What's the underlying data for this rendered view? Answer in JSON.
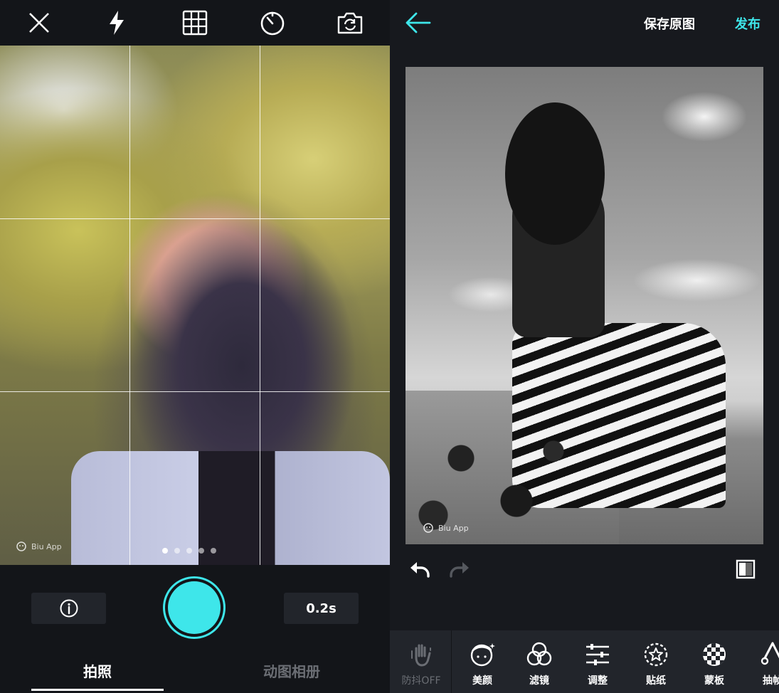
{
  "camera": {
    "top_icons": [
      "close-icon",
      "flash-icon",
      "grid-icon",
      "timer-icon",
      "switch-camera-icon"
    ],
    "watermark": "Biu App",
    "page_dots": 5,
    "active_dot": 0,
    "info_icon": "info-icon",
    "duration": "0.2s",
    "tabs": [
      {
        "label": "拍照",
        "active": true
      },
      {
        "label": "动图相册",
        "active": false
      }
    ],
    "accent": "#3ee6ea"
  },
  "editor": {
    "save_original": "保存原图",
    "publish": "发布",
    "watermark": "Biu App",
    "tools": [
      {
        "label": "防抖OFF",
        "icon": "hand-icon",
        "enabled": false
      },
      {
        "label": "美颜",
        "icon": "face-icon",
        "enabled": true
      },
      {
        "label": "滤镜",
        "icon": "filter-icon",
        "enabled": true
      },
      {
        "label": "调整",
        "icon": "sliders-icon",
        "enabled": true
      },
      {
        "label": "贴纸",
        "icon": "sticker-icon",
        "enabled": true
      },
      {
        "label": "蒙板",
        "icon": "mask-icon",
        "enabled": true
      },
      {
        "label": "抽帧",
        "icon": "frame-icon",
        "enabled": true
      }
    ]
  }
}
